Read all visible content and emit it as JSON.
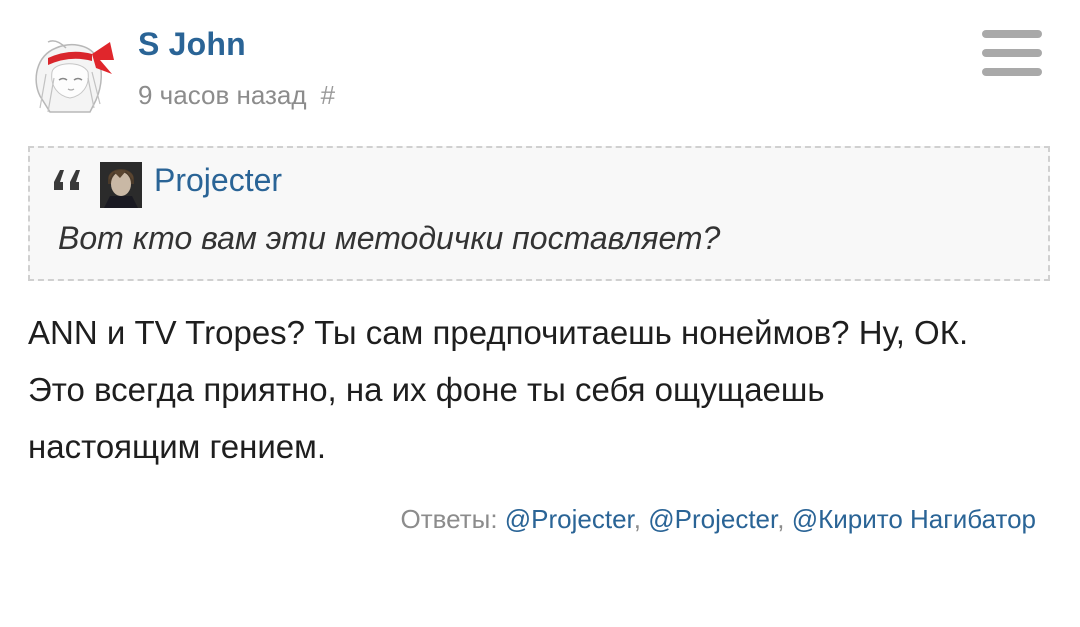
{
  "post": {
    "author": "S John",
    "time": "9 часов назад",
    "permalink": "#",
    "avatar_icon": "anime-girl-red-ribbon-avatar",
    "menu_icon": "hamburger-menu-icon"
  },
  "quote": {
    "author": "Projecter",
    "text": "Вот кто вам эти методички поставляет?",
    "quote_icon": "quote-marks-icon"
  },
  "body": {
    "lines": [
      "ANN и TV Tropes? Ты сам предпочитаешь нонеймов? Ну, ОК.",
      "Это всегда приятно, на их фоне ты себя ощущаешь",
      "настоящим гением."
    ]
  },
  "replies": {
    "label": "Ответы:",
    "users": [
      "@Projecter",
      "@Projecter",
      "@Кирито Нагибатор"
    ]
  },
  "colors": {
    "link": "#2a6496",
    "meta": "#8c8c8c",
    "quote_bg": "#f8f8f8",
    "quote_border": "#d0d0d0"
  }
}
